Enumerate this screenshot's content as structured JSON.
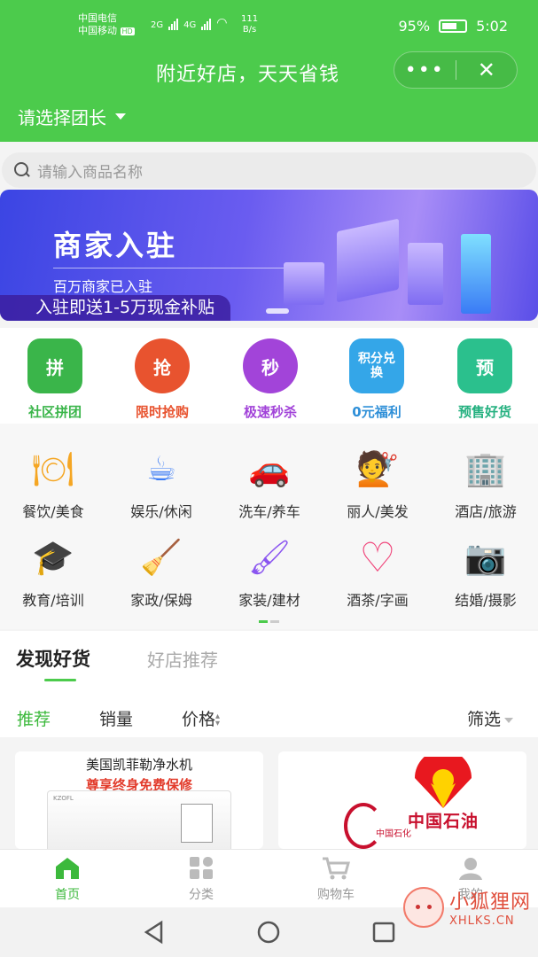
{
  "status_bar": {
    "carrier1": "中国电信",
    "carrier2": "中国移动",
    "hd": "HD",
    "net1": "2G",
    "net2": "4G",
    "speed_value": "111",
    "speed_unit": "B/s",
    "battery": "95%",
    "time": "5:02"
  },
  "header": {
    "title": "附近好店，天天省钱",
    "more_icon": "more-dots-icon",
    "close_icon": "close-icon",
    "leader_select": "请选择团长"
  },
  "search": {
    "placeholder": "请输入商品名称"
  },
  "banner": {
    "title": "商家入驻",
    "subtitle": "百万商家已入驻",
    "promo": "入驻即送1-5万现金补贴"
  },
  "quick_entries": [
    {
      "label": "社区拼团",
      "icon_text": "拼",
      "color": "#3ab54a",
      "label_color": "#3ab54a"
    },
    {
      "label": "限时抢购",
      "icon_text": "抢",
      "color": "#e8532f",
      "label_color": "#e8532f"
    },
    {
      "label": "极速秒杀",
      "icon_text": "秒",
      "color": "#a244d9",
      "label_color": "#a244d9"
    },
    {
      "label": "0元福利",
      "icon_text": "积分兑换",
      "color": "#34a6e8",
      "label_color": "#2e8fd8"
    },
    {
      "label": "预售好货",
      "icon_text": "预",
      "color": "#2bc08d",
      "label_color": "#23b07f"
    }
  ],
  "categories": [
    {
      "label": "餐饮/美食",
      "icon": "food-cover-icon",
      "glyph": "🍽",
      "color": "#f5a623"
    },
    {
      "label": "娱乐/休闲",
      "icon": "coffee-cup-icon",
      "glyph": "☕",
      "color": "#3a7bf5"
    },
    {
      "label": "洗车/养车",
      "icon": "car-icon",
      "glyph": "🚗",
      "color": "#f5842a"
    },
    {
      "label": "丽人/美发",
      "icon": "hair-icon",
      "glyph": "💇",
      "color": "#f0503c"
    },
    {
      "label": "酒店/旅游",
      "icon": "hotel-building-icon",
      "glyph": "🏢",
      "color": "#3a5ef0"
    },
    {
      "label": "教育/培训",
      "icon": "graduation-cap-icon",
      "glyph": "🎓",
      "color": "#1fb6d6"
    },
    {
      "label": "家政/保姆",
      "icon": "broom-icon",
      "glyph": "🧹",
      "color": "#7a57f0"
    },
    {
      "label": "家装/建材",
      "icon": "paint-roller-icon",
      "glyph": "🖌",
      "color": "#8a55f0"
    },
    {
      "label": "酒茶/字画",
      "icon": "heart-icon",
      "glyph": "♡",
      "color": "#f0457a"
    },
    {
      "label": "结婚/摄影",
      "icon": "camera-icon",
      "glyph": "📷",
      "color": "#9a5cf0"
    }
  ],
  "tabs": {
    "active": "发现好货",
    "other": "好店推荐"
  },
  "sort": {
    "recommend": "推荐",
    "sales": "销量",
    "price": "价格",
    "filter": "筛选"
  },
  "products": [
    {
      "title": "美国凯菲勒净水机",
      "subtitle": "尊享终身免费保修",
      "brand": "KZOFL"
    },
    {
      "title": "中国石油",
      "subtitle": "中国石化"
    }
  ],
  "bottom_nav": [
    {
      "label": "首页",
      "icon": "home-icon"
    },
    {
      "label": "分类",
      "icon": "category-grid-icon"
    },
    {
      "label": "购物车",
      "icon": "cart-icon"
    },
    {
      "label": "我的",
      "icon": "user-icon"
    }
  ],
  "watermark": {
    "cn": "小狐狸网",
    "en": "XHLKS.CN"
  },
  "colors": {
    "brand_green": "#4ccb4c",
    "active_green": "#3cb93c"
  }
}
